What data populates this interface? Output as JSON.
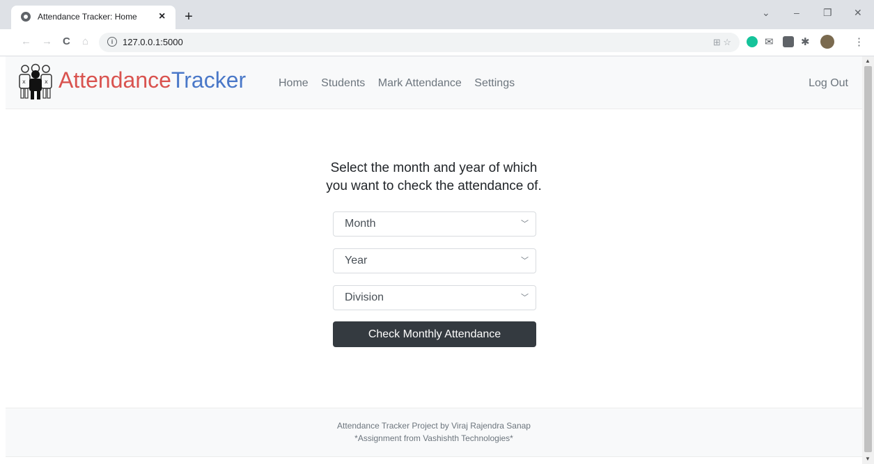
{
  "browser": {
    "tab_title": "Attendance Tracker: Home",
    "tab_close": "×",
    "new_tab": "+",
    "url": "127.0.0.1:5000",
    "window_controls": {
      "menu": "⌄",
      "minimize": "–",
      "restore": "❐",
      "close": "✕"
    },
    "toolbar_icons": {
      "back": "←",
      "forward": "→",
      "reload": "C",
      "home": "⌂"
    },
    "ext_colors": {
      "grammarly": "#15c39a",
      "mail": "#5f6368",
      "profile": "#7a6a4f"
    }
  },
  "navbar": {
    "brand_part1": "Attendance",
    "brand_part2": "Tracker",
    "brand_color1": "#d9534f",
    "brand_color2": "#4a78c8",
    "links": [
      "Home",
      "Students",
      "Mark Attendance",
      "Settings"
    ],
    "logout": "Log Out"
  },
  "main": {
    "prompt_line1": "Select the month and year of which",
    "prompt_line2": "you want to check the attendance of.",
    "month_select": "Month",
    "year_select": "Year",
    "division_select": "Division",
    "submit_button": "Check Monthly Attendance",
    "button_color": "#343a40"
  },
  "footer": {
    "line1": "Attendance Tracker Project by Viraj Rajendra Sanap",
    "line2": "*Assignment from Vashishth Technologies*"
  }
}
